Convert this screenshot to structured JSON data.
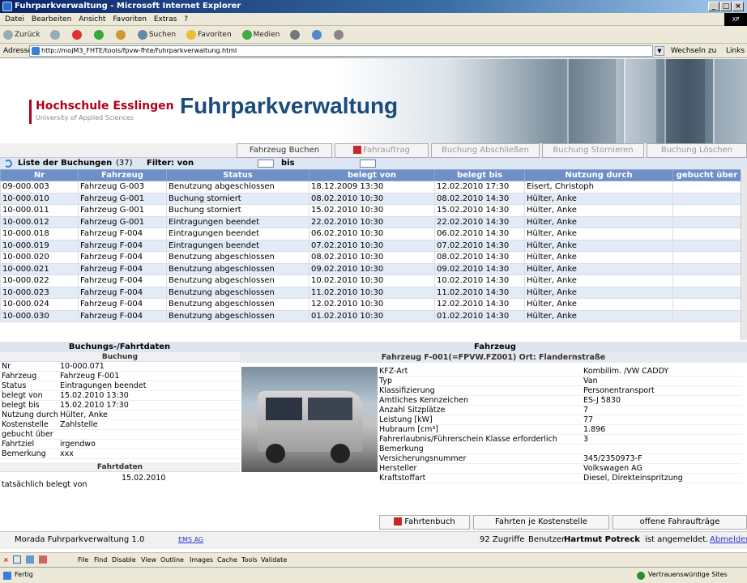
{
  "window": {
    "title": "Fuhrparkverwaltung - Microsoft Internet Explorer",
    "minimize": "_",
    "maximize": "□",
    "close": "×",
    "logo": "XP"
  },
  "menu": [
    "Datei",
    "Bearbeiten",
    "Ansicht",
    "Favoriten",
    "Extras",
    "?"
  ],
  "toolbar": {
    "back": "Zurück",
    "search": "Suchen",
    "favorites": "Favoriten",
    "media": "Medien"
  },
  "address": {
    "label": "Adresse",
    "url": "http://mojM3_FHTE/tools/fpvw-fhte/fuhrparkverwaltung.html",
    "go": "Wechseln zu",
    "links": "Links"
  },
  "brand": {
    "school": "Hochschule Esslingen",
    "subtitle": "University of Applied Sciences",
    "app_title": "Fuhrparkverwaltung"
  },
  "actions": [
    {
      "label": "Fahrzeug Buchen",
      "enabled": true
    },
    {
      "label": "Fahrauftrag",
      "enabled": false
    },
    {
      "label": "Buchung Abschließen",
      "enabled": false
    },
    {
      "label": "Buchung Stornieren",
      "enabled": false
    },
    {
      "label": "Buchung Löschen",
      "enabled": false
    }
  ],
  "filter": {
    "list_label": "Liste der Buchungen",
    "count": "(37)",
    "filter_label": "Filter: von",
    "bis_label": "bis"
  },
  "table": {
    "headers": [
      "Nr",
      "Fahrzeug",
      "Status",
      "belegt von",
      "belegt bis",
      "Nutzung durch",
      "gebucht über"
    ],
    "rows": [
      [
        "09-000.003",
        "Fahrzeug G-003",
        "Benutzung abgeschlossen",
        "18.12.2009 13:30",
        "12.02.2010 17:30",
        "Eisert, Christoph",
        ""
      ],
      [
        "10-000.010",
        "Fahrzeug G-001",
        "Buchung storniert",
        "08.02.2010 10:30",
        "08.02.2010 14:30",
        "Hülter, Anke",
        ""
      ],
      [
        "10-000.011",
        "Fahrzeug G-001",
        "Buchung storniert",
        "15.02.2010 10:30",
        "15.02.2010 14:30",
        "Hülter, Anke",
        ""
      ],
      [
        "10-000.012",
        "Fahrzeug G-001",
        "Eintragungen beendet",
        "22.02.2010 10:30",
        "22.02.2010 14:30",
        "Hülter, Anke",
        ""
      ],
      [
        "10-000.018",
        "Fahrzeug F-004",
        "Eintragungen beendet",
        "06.02.2010 10:30",
        "06.02.2010 14:30",
        "Hülter, Anke",
        ""
      ],
      [
        "10-000.019",
        "Fahrzeug F-004",
        "Eintragungen beendet",
        "07.02.2010 10:30",
        "07.02.2010 14:30",
        "Hülter, Anke",
        ""
      ],
      [
        "10-000.020",
        "Fahrzeug F-004",
        "Benutzung abgeschlossen",
        "08.02.2010 10:30",
        "08.02.2010 14:30",
        "Hülter, Anke",
        ""
      ],
      [
        "10-000.021",
        "Fahrzeug F-004",
        "Benutzung abgeschlossen",
        "09.02.2010 10:30",
        "09.02.2010 14:30",
        "Hülter, Anke",
        ""
      ],
      [
        "10-000.022",
        "Fahrzeug F-004",
        "Benutzung abgeschlossen",
        "10.02.2010 10:30",
        "10.02.2010 14:30",
        "Hülter, Anke",
        ""
      ],
      [
        "10-000.023",
        "Fahrzeug F-004",
        "Benutzung abgeschlossen",
        "11.02.2010 10:30",
        "11.02.2010 14:30",
        "Hülter, Anke",
        ""
      ],
      [
        "10-000.024",
        "Fahrzeug F-004",
        "Benutzung abgeschlossen",
        "12.02.2010 10:30",
        "12.02.2010 14:30",
        "Hülter, Anke",
        ""
      ],
      [
        "10-000.030",
        "Fahrzeug F-004",
        "Benutzung abgeschlossen",
        "01.02.2010 10:30",
        "01.02.2010 14:30",
        "Hülter, Anke",
        ""
      ]
    ]
  },
  "booking_panel": {
    "title": "Buchungs-/Fahrtdaten",
    "section": "Buchung",
    "fields": [
      {
        "label": "Nr",
        "value": "10-000.071"
      },
      {
        "label": "Fahrzeug",
        "value": "Fahrzeug F-001"
      },
      {
        "label": "Status",
        "value": "Eintragungen beendet"
      },
      {
        "label": "belegt von",
        "value": "15.02.2010 13:30"
      },
      {
        "label": "belegt bis",
        "value": "15.02.2010 17:30"
      },
      {
        "label": "Nutzung durch",
        "value": "Hülter, Anke"
      },
      {
        "label": "Kostenstelle",
        "value": "Zahlstelle"
      },
      {
        "label": "gebucht über",
        "value": ""
      },
      {
        "label": "Fahrtziel",
        "value": "irgendwo"
      },
      {
        "label": "Bemerkung",
        "value": "xxx"
      }
    ],
    "trip_section": "Fahrtdaten",
    "trip_label": "tatsächlich belegt von",
    "trip_value": "15.02.2010"
  },
  "vehicle_panel": {
    "title": "Fahrzeug",
    "header": "Fahrzeug F-001(=FPVW.FZ001) Ort: Flandernstraße",
    "props": [
      {
        "label": "KFZ-Art",
        "value": "Kombilim. /VW CADDY"
      },
      {
        "label": "Typ",
        "value": "Van"
      },
      {
        "label": "Klassifizierung",
        "value": "Personentransport"
      },
      {
        "label": "Amtliches Kennzeichen",
        "value": "ES-J 5830"
      },
      {
        "label": "Anzahl Sitzplätze",
        "value": "7"
      },
      {
        "label": "Leistung [kW]",
        "value": "77"
      },
      {
        "label": "Hubraum [cm³]",
        "value": "1.896"
      },
      {
        "label": "Fahrerlaubnis/Führerschein Klasse erforderlich",
        "value": "3"
      },
      {
        "label": "Bemerkung",
        "value": ""
      },
      {
        "label": "Versicherungsnummer",
        "value": "345/2350973-F"
      },
      {
        "label": "Hersteller",
        "value": "Volkswagen AG"
      },
      {
        "label": "Kraftstoffart",
        "value": "Diesel, Direkteinspritzung"
      }
    ]
  },
  "bottom_buttons": [
    "Fahrtenbuch",
    "Fahrten je Kostenstelle",
    "offene Fahraufträge"
  ],
  "app_status": {
    "version": "Morada Fuhrparkverwaltung 1.0",
    "ems": "EMS AG",
    "hits": "92 Zugriffe",
    "user_prefix": "Benutzer",
    "user": "Hartmut Potreck",
    "user_suffix": "ist angemeldet.",
    "logout": "Abmelden"
  },
  "devbar": [
    "File",
    "Find",
    "Disable",
    "View",
    "Outline",
    "Images",
    "Cache",
    "Tools",
    "Validate"
  ],
  "statusbar": {
    "left": "Fertig",
    "zone": "Vertrauenswürdige Sites"
  }
}
